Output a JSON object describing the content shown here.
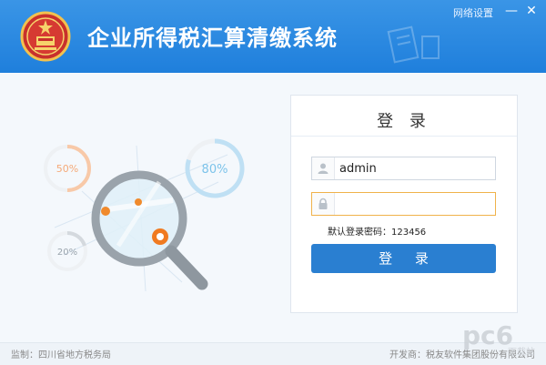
{
  "app": {
    "title": "企业所得税汇算清缴系统"
  },
  "window": {
    "network_settings": "网络设置",
    "minimize": "—",
    "close": "✕"
  },
  "illustration": {
    "stat1": "50%",
    "stat2": "80%",
    "stat3": "20%"
  },
  "login": {
    "title": "登 录",
    "username": "admin",
    "password": "",
    "hint": "默认登录密码：123456",
    "button": "登 录",
    "user_icon": "user-icon",
    "lock_icon": "lock-icon"
  },
  "footer": {
    "supervisor": "监制：四川省地方税务局",
    "developer": "开发商：税友软件集团股份有限公司"
  },
  "watermark": {
    "text": "pc6",
    "sub": "下载站"
  },
  "colors": {
    "header": "#1f7fdc",
    "button": "#2a7fd1",
    "focus": "#f0b24a"
  }
}
